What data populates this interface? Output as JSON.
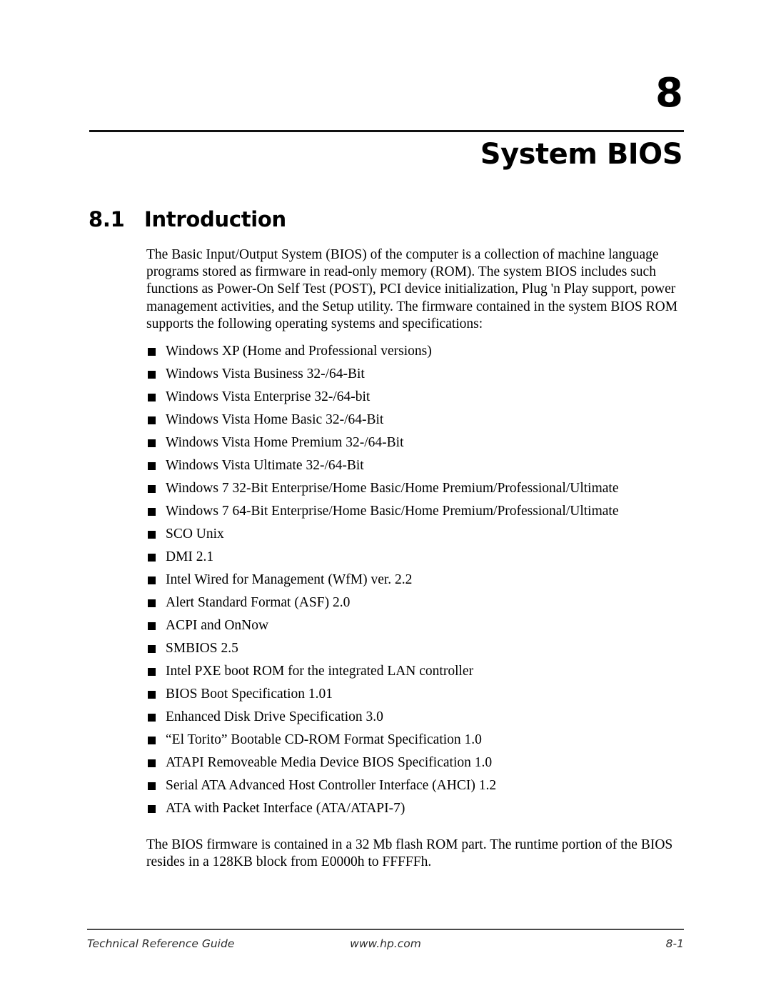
{
  "chapter": {
    "number": "8",
    "title": "System BIOS"
  },
  "section": {
    "number": "8.1",
    "title": "Introduction"
  },
  "intro_paragraph": "The Basic Input/Output System (BIOS) of the computer is a collection of machine language programs stored as firmware in read-only memory (ROM). The system BIOS includes such functions as Power-On Self Test (POST), PCI device initialization, Plug 'n Play support, power management activities, and the Setup utility. The firmware contained in the system BIOS ROM supports the following operating systems and specifications:",
  "spec_list": [
    "Windows XP (Home and Professional versions)",
    "Windows Vista Business 32-/64-Bit",
    "Windows Vista Enterprise 32-/64-bit",
    "Windows Vista Home Basic 32-/64-Bit",
    "Windows Vista Home Premium 32-/64-Bit",
    "Windows Vista Ultimate 32-/64-Bit",
    "Windows 7 32-Bit Enterprise/Home Basic/Home Premium/Professional/Ultimate",
    "Windows 7 64-Bit Enterprise/Home Basic/Home Premium/Professional/Ultimate",
    "SCO Unix",
    "DMI 2.1",
    "Intel Wired for Management (WfM) ver. 2.2",
    "Alert Standard Format (ASF) 2.0",
    "ACPI and OnNow",
    "SMBIOS 2.5",
    "Intel PXE boot ROM for the integrated LAN controller",
    "BIOS Boot Specification 1.01",
    "Enhanced Disk Drive Specification 3.0",
    "“El Torito” Bootable CD-ROM Format Specification 1.0",
    "ATAPI Removeable Media Device BIOS Specification 1.0",
    "Serial ATA Advanced Host Controller Interface (AHCI) 1.2",
    "ATA with Packet Interface (ATA/ATAPI-7)"
  ],
  "closing_paragraph": "The BIOS firmware is contained in a 32 Mb flash ROM part. The runtime portion of the BIOS resides in a 128KB block from E0000h to FFFFFh.",
  "footer": {
    "left": "Technical Reference Guide",
    "center": "www.hp.com",
    "right": "8-1"
  },
  "colors": {
    "text": "#000000",
    "rule": "#111111",
    "footer_rule": "#4a4a4a",
    "footer_text": "#2b2b2b",
    "background": "#ffffff"
  }
}
